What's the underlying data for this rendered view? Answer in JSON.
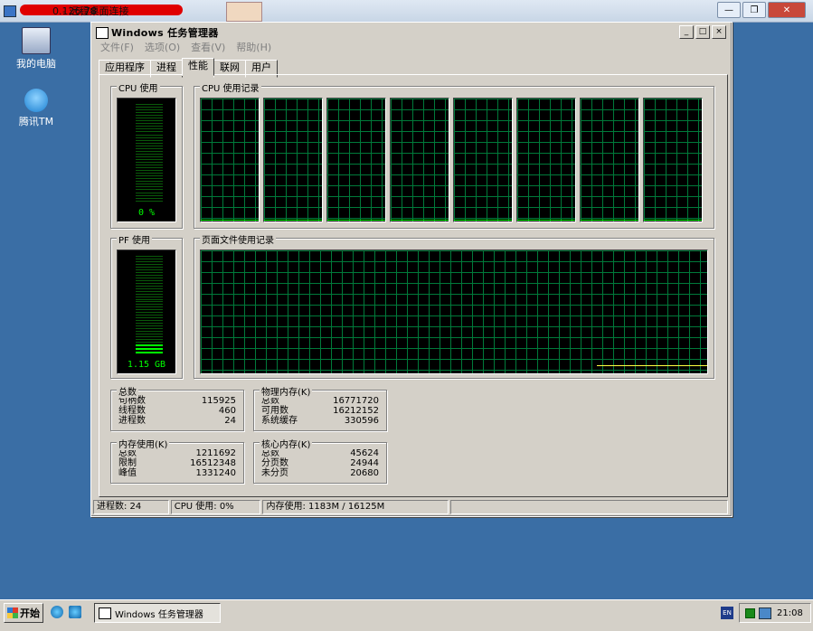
{
  "remote": {
    "title_visible": "0.126.78",
    "title_suffix": "- 远程桌面连接"
  },
  "desktop": {
    "icons": [
      {
        "label": "我的电脑"
      },
      {
        "label": "腾讯TM"
      }
    ]
  },
  "window": {
    "title": "Windows 任务管理器",
    "controls": [
      "_",
      "□",
      "×"
    ],
    "menu": [
      "文件(F)",
      "选项(O)",
      "查看(V)",
      "帮助(H)"
    ],
    "tabs": [
      "应用程序",
      "进程",
      "性能",
      "联网",
      "用户"
    ],
    "active_tab": "性能"
  },
  "performance": {
    "cpu_usage": {
      "label": "CPU 使用",
      "value": "0 %",
      "percent": 0
    },
    "cpu_history": {
      "label": "CPU 使用记录",
      "core_count": 8
    },
    "pf_usage": {
      "label": "PF 使用",
      "value": "1.15 GB",
      "fraction": 0.07
    },
    "pf_history": {
      "label": "页面文件使用记录"
    },
    "totals": {
      "label": "总数",
      "rows": [
        [
          "句柄数",
          "115925"
        ],
        [
          "线程数",
          "460"
        ],
        [
          "进程数",
          "24"
        ]
      ]
    },
    "physical_memory": {
      "label": "物理内存(K)",
      "rows": [
        [
          "总数",
          "16771720"
        ],
        [
          "可用数",
          "16212152"
        ],
        [
          "系统缓存",
          "330596"
        ]
      ]
    },
    "commit_charge": {
      "label": "内存使用(K)",
      "rows": [
        [
          "总数",
          "1211692"
        ],
        [
          "限制",
          "16512348"
        ],
        [
          "峰值",
          "1331240"
        ]
      ]
    },
    "kernel_memory": {
      "label": "核心内存(K)",
      "rows": [
        [
          "总数",
          "45624"
        ],
        [
          "分页数",
          "24944"
        ],
        [
          "未分页",
          "20680"
        ]
      ]
    }
  },
  "statusbar": {
    "processes": "进程数: 24",
    "cpu": "CPU 使用: 0%",
    "memory": "内存使用: 1183M / 16125M"
  },
  "taskbar": {
    "start": "开始",
    "task_button": "Windows 任务管理器",
    "lang": "EN",
    "time": "21:08"
  }
}
